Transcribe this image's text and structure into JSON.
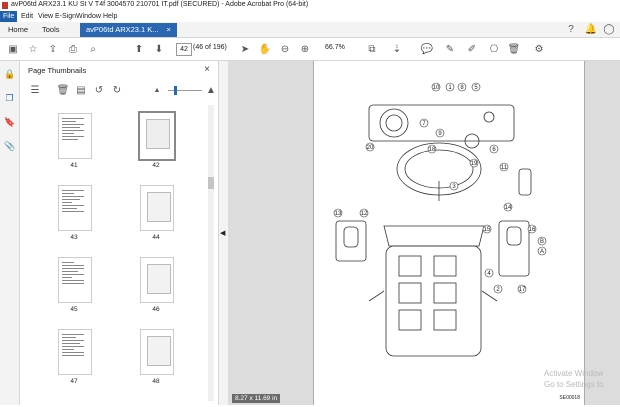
{
  "window": {
    "title": "avP06td ARX23.1 KU St V T4f 3004570 210701 IT.pdf (SECURED) - Adobe Acrobat Pro (64-bit)"
  },
  "menu": [
    "File",
    "Edit",
    "View",
    "E-Sign",
    "Window",
    "Help"
  ],
  "tabs": {
    "home": "Home",
    "tools": "Tools",
    "doc": "avP06td ARX23.1 K...",
    "doc_close": "×"
  },
  "toolbar": {
    "page_current": "42",
    "page_total": "(46 of 196)",
    "zoom": "66.7%"
  },
  "panel": {
    "title": "Page Thumbnails",
    "close": "×"
  },
  "thumbnails": [
    {
      "label": "41"
    },
    {
      "label": "42"
    },
    {
      "label": "43"
    },
    {
      "label": "44"
    },
    {
      "label": "45"
    },
    {
      "label": "46"
    },
    {
      "label": "47"
    },
    {
      "label": "48"
    }
  ],
  "document": {
    "page_size": "8.27 x 11.69 in",
    "figure_code": "SE00018"
  },
  "callouts": [
    "10",
    "1",
    "8",
    "5",
    "7",
    "9",
    "3",
    "6",
    "20",
    "18",
    "19",
    "11",
    "13",
    "12",
    "14",
    "16",
    "15",
    "B",
    "A",
    "4",
    "2",
    "17"
  ],
  "watermark": {
    "line1": "Activate Window",
    "line2": "Go to Settings to"
  },
  "colors": {
    "accent": "#2a67b3",
    "menu_active": "#1f5fa8",
    "pdf_icon": "#c0392b"
  }
}
